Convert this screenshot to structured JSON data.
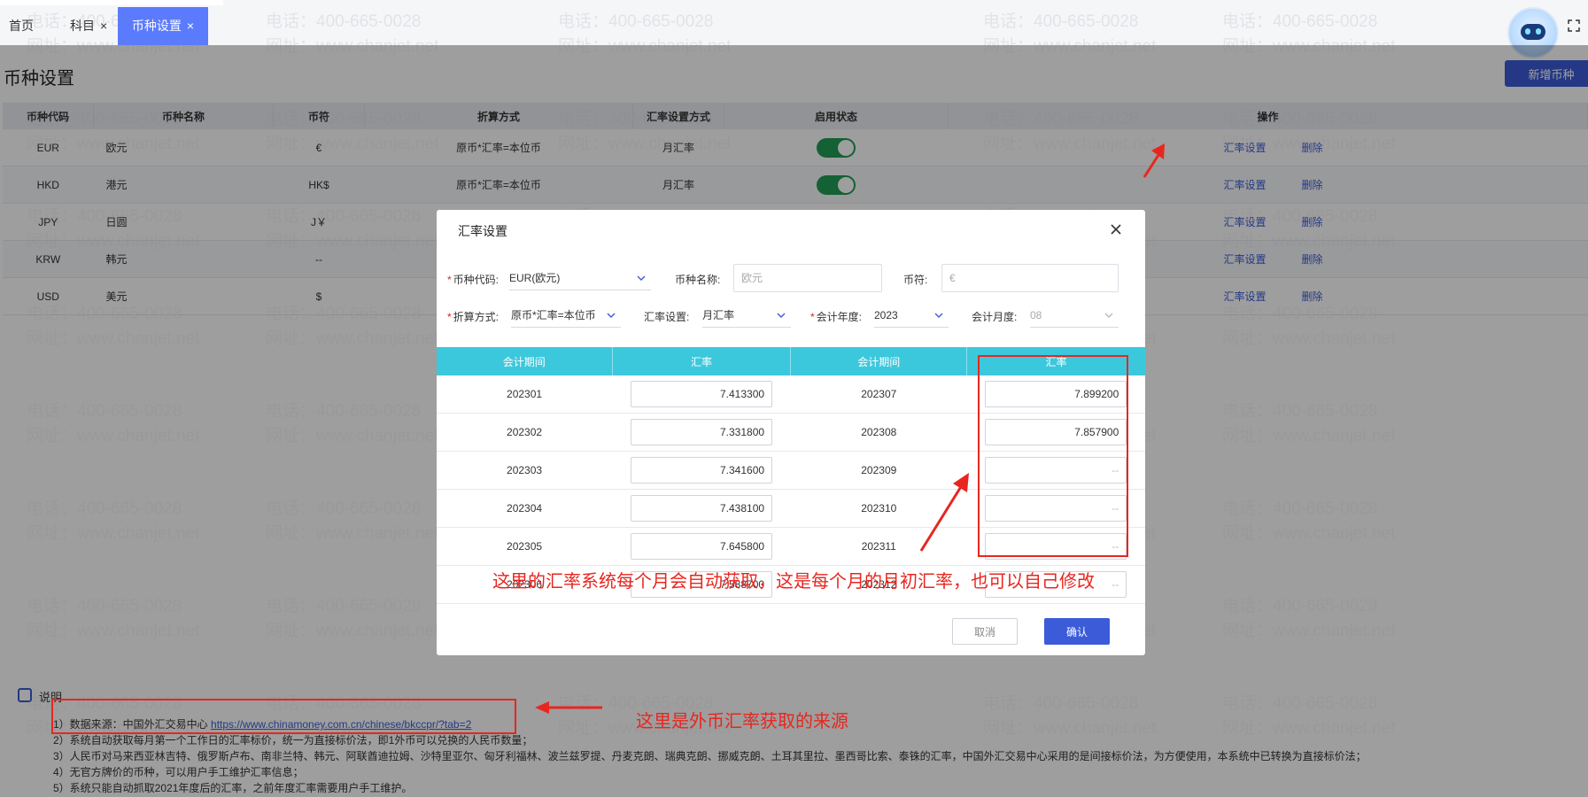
{
  "tabs": [
    {
      "label": "首页",
      "closable": false
    },
    {
      "label": "科目",
      "closable": true
    },
    {
      "label": "币种设置",
      "closable": true,
      "active": true
    }
  ],
  "close_glyph": "×",
  "page": {
    "title": "币种设置",
    "add_button": "新增币种"
  },
  "main_table": {
    "columns": [
      "币种代码",
      "币种名称",
      "币符",
      "折算方式",
      "汇率设置方式",
      "启用状态",
      "操作"
    ],
    "rows": [
      {
        "code": "EUR",
        "name": "欧元",
        "symbol": "€",
        "method": "原币*汇率=本位币",
        "rate_mode": "月汇率",
        "enabled": true
      },
      {
        "code": "HKD",
        "name": "港元",
        "symbol": "HK$",
        "method": "原币*汇率=本位币",
        "rate_mode": "月汇率",
        "enabled": true
      },
      {
        "code": "JPY",
        "name": "日圆",
        "symbol": "J￥",
        "method": "",
        "rate_mode": "",
        "enabled": true
      },
      {
        "code": "KRW",
        "name": "韩元",
        "symbol": "--",
        "method": "",
        "rate_mode": "",
        "enabled": true
      },
      {
        "code": "USD",
        "name": "美元",
        "symbol": "$",
        "method": "",
        "rate_mode": "",
        "enabled": true
      }
    ],
    "action_set_rate": "汇率设置",
    "action_delete": "删除"
  },
  "modal": {
    "title": "汇率设置",
    "currency_code_label": "币种代码:",
    "currency_code_value": "EUR(欧元)",
    "currency_name_label": "币种名称:",
    "currency_name_value": "欧元",
    "symbol_label": "币符:",
    "symbol_value": "€",
    "method_label": "折算方式:",
    "method_value": "原币*汇率=本位币",
    "rate_mode_label": "汇率设置:",
    "rate_mode_value": "月汇率",
    "year_label": "会计年度:",
    "year_value": "2023",
    "month_label": "会计月度:",
    "month_value": "08",
    "columns": [
      "会计期间",
      "汇率",
      "会计期间",
      "汇率"
    ],
    "rows": [
      {
        "p1": "202301",
        "r1": "7.413300",
        "p2": "202307",
        "r2": "7.899200"
      },
      {
        "p1": "202302",
        "r1": "7.331800",
        "p2": "202308",
        "r2": "7.857900"
      },
      {
        "p1": "202303",
        "r1": "7.341600",
        "p2": "202309",
        "r2": "--"
      },
      {
        "p1": "202304",
        "r1": "7.438100",
        "p2": "202310",
        "r2": "--"
      },
      {
        "p1": "202305",
        "r1": "7.645800",
        "p2": "202311",
        "r2": "--"
      },
      {
        "p1": "202306",
        "r1": "7.588700",
        "p2": "202312",
        "r2": "--"
      }
    ],
    "cancel": "取消",
    "confirm": "确认"
  },
  "notes": {
    "heading": "说明",
    "lines": [
      {
        "prefix": "1）数据来源：中国外汇交易中心 ",
        "link": "https://www.chinamoney.com.cn/chinese/bkccpr/?tab=2"
      },
      {
        "prefix": "2）系统自动获取每月第一个工作日的汇率标价，统一为直接标价法，即1外币可以兑换的人民币数量；"
      },
      {
        "prefix": "3）人民币对马来西亚林吉特、俄罗斯卢布、南非兰特、韩元、阿联酋迪拉姆、沙特里亚尔、匈牙利福林、波兰兹罗提、丹麦克朗、瑞典克朗、挪威克朗、土耳其里拉、墨西哥比索、泰铢的汇率，中国外汇交易中心采用的是间接标价法，为方便使用，本系统中已转换为直接标价法；"
      },
      {
        "prefix": "4）无官方牌价的币种，可以用户手工维护汇率信息；"
      },
      {
        "prefix": "5）系统只能自动抓取2021年度后的汇率，之前年度汇率需要用户手工维护。"
      }
    ]
  },
  "annotations": {
    "rate_note": "这里的汇率系统每个月会自动获取，这是每个月的月初汇率，也可以自己修改",
    "source_note": "这里是外币汇率获取的来源"
  },
  "watermark": {
    "phone": "电话：400-665-0028",
    "site": "网址：www.chanjet.net"
  },
  "colors": {
    "accent": "#3b5bd9",
    "table_header": "#3cc8dc",
    "toggle_on": "#1f9d55",
    "annotation": "#e8261f"
  }
}
